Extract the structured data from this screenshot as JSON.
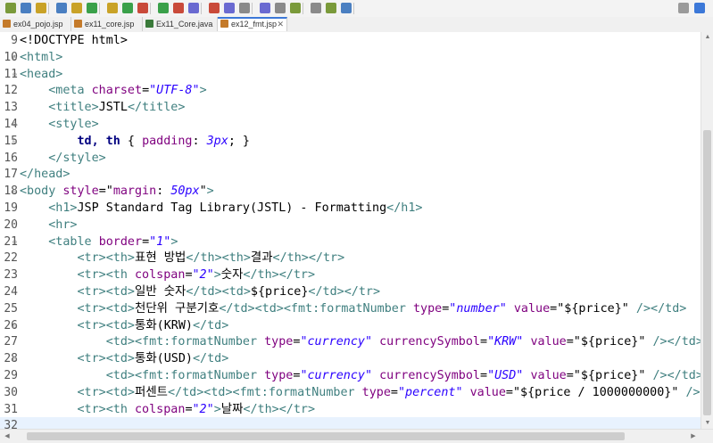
{
  "theme": {
    "tag": "#3f7f7f",
    "attr": "#7f007f",
    "value": "#2a00ff",
    "text": "#000000",
    "el_bold": "#000080",
    "css_prop": "#7f007f",
    "css_val": "#2a00ff",
    "el_jsp": "#3f7f7f",
    "tab_active_border": "#3c78d8"
  },
  "toolbar": {
    "icons": [
      "run-icon",
      "debug-icon",
      "server-icon",
      "search-icon",
      "back-icon",
      "forward-icon",
      "perspective-icon"
    ]
  },
  "tabs": [
    {
      "label": "ex04_pojo.jsp",
      "active": false
    },
    {
      "label": "ex11_core.jsp",
      "active": false
    },
    {
      "label": "Ex11_Core.java",
      "active": false
    },
    {
      "label": "ex12_fmt.jsp",
      "active": true
    }
  ],
  "editor": {
    "lines": [
      {
        "n": "9",
        "fold": false,
        "tokens": [
          [
            "t",
            "<!DOCTYPE html>"
          ]
        ]
      },
      {
        "n": "10",
        "fold": true,
        "tokens": [
          [
            "tag",
            "<html>"
          ]
        ]
      },
      {
        "n": "11",
        "fold": true,
        "tokens": [
          [
            "tag",
            "<head>"
          ]
        ]
      },
      {
        "n": "12",
        "fold": false,
        "tokens": [
          [
            "x",
            "    "
          ],
          [
            "tag",
            "<meta "
          ],
          [
            "attr",
            "charset"
          ],
          [
            "t",
            "="
          ],
          [
            "val",
            "\"UTF-8\""
          ],
          [
            "tag",
            ">"
          ]
        ]
      },
      {
        "n": "13",
        "fold": false,
        "tokens": [
          [
            "x",
            "    "
          ],
          [
            "tag",
            "<title>"
          ],
          [
            "t",
            "JSTL"
          ],
          [
            "tag",
            "</title>"
          ]
        ]
      },
      {
        "n": "14",
        "fold": true,
        "tokens": [
          [
            "x",
            "    "
          ],
          [
            "tag",
            "<style>"
          ]
        ]
      },
      {
        "n": "15",
        "fold": true,
        "tokens": [
          [
            "x",
            "        "
          ],
          [
            "sel",
            "td, th"
          ],
          [
            "t",
            " { "
          ],
          [
            "prop",
            "padding"
          ],
          [
            "t",
            ": "
          ],
          [
            "cval",
            "3px"
          ],
          [
            "t",
            "; }"
          ]
        ]
      },
      {
        "n": "16",
        "fold": false,
        "tokens": [
          [
            "x",
            "    "
          ],
          [
            "tag",
            "</style>"
          ]
        ]
      },
      {
        "n": "17",
        "fold": false,
        "tokens": [
          [
            "tag",
            "</head>"
          ]
        ]
      },
      {
        "n": "18",
        "fold": true,
        "tokens": [
          [
            "tag",
            "<body "
          ],
          [
            "attr",
            "style"
          ],
          [
            "t",
            "=\""
          ],
          [
            "prop",
            "margin"
          ],
          [
            "t",
            ": "
          ],
          [
            "cval",
            "50px"
          ],
          [
            "t",
            "\""
          ],
          [
            "tag",
            ">"
          ]
        ]
      },
      {
        "n": "19",
        "fold": false,
        "tokens": [
          [
            "x",
            "    "
          ],
          [
            "tag",
            "<h1>"
          ],
          [
            "t",
            "JSP Standard Tag Library(JSTL) - Formatting"
          ],
          [
            "tag",
            "</h1>"
          ]
        ]
      },
      {
        "n": "20",
        "fold": false,
        "tokens": [
          [
            "x",
            "    "
          ],
          [
            "tag",
            "<hr>"
          ]
        ]
      },
      {
        "n": "21",
        "fold": true,
        "tokens": [
          [
            "x",
            "    "
          ],
          [
            "tag",
            "<table "
          ],
          [
            "attr",
            "border"
          ],
          [
            "t",
            "="
          ],
          [
            "val",
            "\"1\""
          ],
          [
            "tag",
            ">"
          ]
        ]
      },
      {
        "n": "22",
        "fold": false,
        "tokens": [
          [
            "x",
            "        "
          ],
          [
            "tag",
            "<tr><th>"
          ],
          [
            "t",
            "표현 방법"
          ],
          [
            "tag",
            "</th><th>"
          ],
          [
            "t",
            "결과"
          ],
          [
            "tag",
            "</th></tr>"
          ]
        ]
      },
      {
        "n": "23",
        "fold": false,
        "tokens": [
          [
            "x",
            "        "
          ],
          [
            "tag",
            "<tr><th "
          ],
          [
            "attr",
            "colspan"
          ],
          [
            "t",
            "="
          ],
          [
            "val",
            "\"2\""
          ],
          [
            "tag",
            ">"
          ],
          [
            "t",
            "숫자"
          ],
          [
            "tag",
            "</th></tr>"
          ]
        ]
      },
      {
        "n": "24",
        "fold": false,
        "tokens": [
          [
            "x",
            "        "
          ],
          [
            "tag",
            "<tr><td>"
          ],
          [
            "t",
            "일반 숫자"
          ],
          [
            "tag",
            "</td><td>"
          ],
          [
            "t",
            "${price}"
          ],
          [
            "tag",
            "</td></tr>"
          ]
        ]
      },
      {
        "n": "25",
        "fold": false,
        "tokens": [
          [
            "x",
            "        "
          ],
          [
            "tag",
            "<tr><td>"
          ],
          [
            "t",
            "천단위 구분기호"
          ],
          [
            "tag",
            "</td><td><fmt:formatNumber "
          ],
          [
            "attr",
            "type"
          ],
          [
            "t",
            "="
          ],
          [
            "val",
            "\"number\""
          ],
          [
            "t",
            " "
          ],
          [
            "attr",
            "value"
          ],
          [
            "t",
            "=\"${price}\" "
          ],
          [
            "tag",
            "/></td>"
          ]
        ]
      },
      {
        "n": "26",
        "fold": true,
        "tokens": [
          [
            "x",
            "        "
          ],
          [
            "tag",
            "<tr><td>"
          ],
          [
            "t",
            "통화(KRW)"
          ],
          [
            "tag",
            "</td>"
          ]
        ]
      },
      {
        "n": "27",
        "fold": false,
        "tokens": [
          [
            "x",
            "            "
          ],
          [
            "tag",
            "<td><fmt:formatNumber "
          ],
          [
            "attr",
            "type"
          ],
          [
            "t",
            "="
          ],
          [
            "val",
            "\"currency\""
          ],
          [
            "t",
            " "
          ],
          [
            "attr",
            "currencySymbol"
          ],
          [
            "t",
            "="
          ],
          [
            "val",
            "\"KRW\""
          ],
          [
            "t",
            " "
          ],
          [
            "attr",
            "value"
          ],
          [
            "t",
            "=\"${price}\" "
          ],
          [
            "tag",
            "/></td><"
          ]
        ]
      },
      {
        "n": "28",
        "fold": true,
        "tokens": [
          [
            "x",
            "        "
          ],
          [
            "tag",
            "<tr><td>"
          ],
          [
            "t",
            "통화(USD)"
          ],
          [
            "tag",
            "</td>"
          ]
        ]
      },
      {
        "n": "29",
        "fold": false,
        "tokens": [
          [
            "x",
            "            "
          ],
          [
            "tag",
            "<td><fmt:formatNumber "
          ],
          [
            "attr",
            "type"
          ],
          [
            "t",
            "="
          ],
          [
            "val",
            "\"currency\""
          ],
          [
            "t",
            " "
          ],
          [
            "attr",
            "currencySymbol"
          ],
          [
            "t",
            "="
          ],
          [
            "val",
            "\"USD\""
          ],
          [
            "t",
            " "
          ],
          [
            "attr",
            "value"
          ],
          [
            "t",
            "=\"${price}\" "
          ],
          [
            "tag",
            "/></td><"
          ]
        ]
      },
      {
        "n": "30",
        "fold": false,
        "tokens": [
          [
            "x",
            "        "
          ],
          [
            "tag",
            "<tr><td>"
          ],
          [
            "t",
            "퍼센트"
          ],
          [
            "tag",
            "</td><td><fmt:formatNumber "
          ],
          [
            "attr",
            "type"
          ],
          [
            "t",
            "="
          ],
          [
            "val",
            "\"percent\""
          ],
          [
            "t",
            " "
          ],
          [
            "attr",
            "value"
          ],
          [
            "t",
            "=\"${price / 1000000000}\" "
          ],
          [
            "tag",
            "/>"
          ]
        ]
      },
      {
        "n": "31",
        "fold": false,
        "tokens": [
          [
            "x",
            "        "
          ],
          [
            "tag",
            "<tr><th "
          ],
          [
            "attr",
            "colspan"
          ],
          [
            "t",
            "="
          ],
          [
            "val",
            "\"2\""
          ],
          [
            "tag",
            ">"
          ],
          [
            "t",
            "날짜"
          ],
          [
            "tag",
            "</th></tr>"
          ]
        ]
      },
      {
        "n": "32",
        "fold": false,
        "current": true,
        "tokens": []
      }
    ]
  }
}
